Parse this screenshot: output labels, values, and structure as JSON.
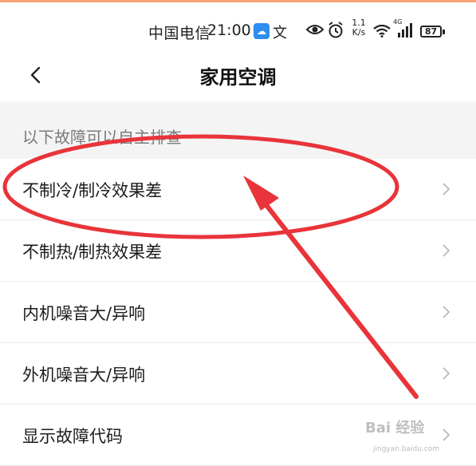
{
  "status_bar": {
    "carrier": "中国电信",
    "time": "21:00",
    "translate_glyph": "文",
    "net_speed_value": "1.1",
    "net_speed_unit": "K/s",
    "signal_type": "4G",
    "battery": "87"
  },
  "header": {
    "title": "家用空调"
  },
  "section": {
    "title": "以下故障可以自主排查"
  },
  "list": [
    {
      "label": "不制冷/制冷效果差"
    },
    {
      "label": "不制热/制热效果差"
    },
    {
      "label": "内机噪音大/异响"
    },
    {
      "label": "外机噪音大/异响"
    },
    {
      "label": "显示故障代码"
    }
  ],
  "watermark": {
    "text": "Bai 经验",
    "url_text": "jingyan.baidu.com"
  },
  "colors": {
    "annotation_red": "#e8343a",
    "accent_orange": "#f6a37a"
  }
}
